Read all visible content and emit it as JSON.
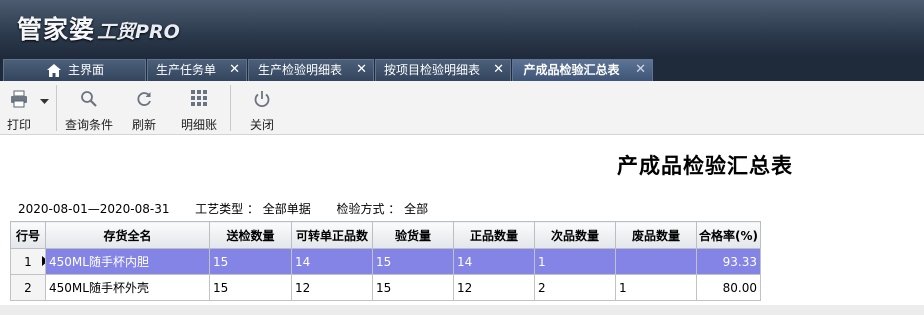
{
  "app": {
    "logo_main": "管家婆",
    "logo_sub": "工贸PRO"
  },
  "tabs": [
    {
      "label": "主界面",
      "closable": false,
      "active": false,
      "icon": "home-icon"
    },
    {
      "label": "生产任务单",
      "closable": true,
      "active": false
    },
    {
      "label": "生产检验明细表",
      "closable": true,
      "active": false
    },
    {
      "label": "按项目检验明细表",
      "closable": true,
      "active": false
    },
    {
      "label": "产成品检验汇总表",
      "closable": true,
      "active": true
    }
  ],
  "toolbar": {
    "print": {
      "label": "打印",
      "icon": "printer-icon"
    },
    "query": {
      "label": "查询条件",
      "icon": "search-icon"
    },
    "refresh": {
      "label": "刷新",
      "icon": "refresh-icon"
    },
    "detail": {
      "label": "明细账",
      "icon": "grid-icon"
    },
    "close": {
      "label": "关闭",
      "icon": "power-icon"
    }
  },
  "report": {
    "title": "产成品检验汇总表",
    "date_range": "2020-08-01—2020-08-31",
    "process_type_label": "工艺类型 ：",
    "process_type_value": "全部单据",
    "inspect_method_label": "检验方式 ：",
    "inspect_method_value": "全部"
  },
  "table": {
    "columns": [
      "行号",
      "存货全名",
      "送检数量",
      "可转单正品数",
      "验货量",
      "正品数量",
      "次品数量",
      "废品数量",
      "合格率(%)"
    ],
    "rows": [
      [
        "1",
        "450ML随手杯内胆",
        "15",
        "14",
        "15",
        "14",
        "1",
        "",
        "93.33"
      ],
      [
        "2",
        "450ML随手杯外壳",
        "15",
        "12",
        "15",
        "12",
        "2",
        "1",
        "80.00"
      ]
    ],
    "selected_row": 0
  },
  "colors": {
    "banner": "#2c3a4d",
    "selected_row": "#8484e6",
    "tab_active": "#4d6383"
  }
}
